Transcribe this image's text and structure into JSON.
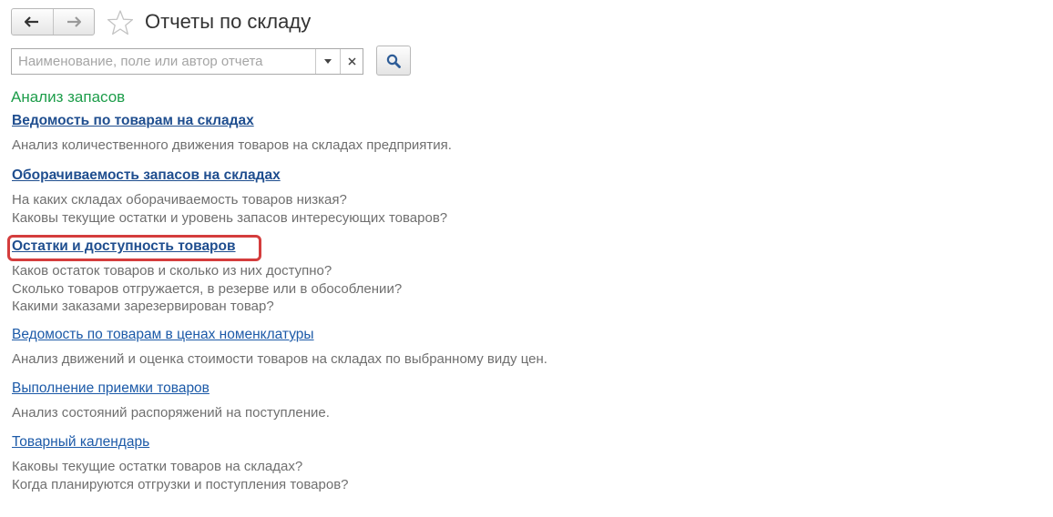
{
  "header": {
    "back_icon": "arrow-left-icon",
    "forward_icon": "arrow-right-icon",
    "favorite_icon": "star-icon",
    "title": "Отчеты по складу"
  },
  "search": {
    "placeholder": "Наименование, поле или автор отчета",
    "value": "",
    "dropdown_icon": "triangle-down-icon",
    "clear_icon": "close-icon",
    "search_icon": "magnifier-icon"
  },
  "section": {
    "title": "Анализ запасов",
    "reports": [
      {
        "label": "Ведомость по товарам на складах",
        "desc": [
          "Анализ количественного движения товаров на складах предприятия."
        ]
      },
      {
        "label": "Оборачиваемость запасов на складах",
        "desc": [
          "На каких складах оборачиваемость товаров низкая?",
          "Каковы текущие остатки и уровень запасов интересующих товаров?"
        ]
      },
      {
        "label": "Остатки и доступность товаров",
        "desc": [
          "Каков остаток товаров и сколько из них доступно?",
          "Сколько товаров отгружается, в резерве или в обособлении?",
          "Какими заказами зарезервирован товар?"
        ]
      },
      {
        "label": "Ведомость по товарам в ценах номенклатуры",
        "desc": [
          "Анализ движений и оценка стоимости товаров на складах по выбранному виду цен."
        ]
      },
      {
        "label": "Выполнение приемки товаров",
        "desc": [
          "Анализ состояний распоряжений на поступление."
        ]
      },
      {
        "label": "Товарный календарь",
        "desc": [
          "Каковы текущие остатки товаров на складах?",
          "Когда планируются отгрузки и поступления товаров?"
        ]
      }
    ]
  },
  "colors": {
    "section_title": "#1d9d4a",
    "link": "#1c5aa8",
    "description": "#6f6f6f",
    "highlight": "#d43d3d"
  }
}
